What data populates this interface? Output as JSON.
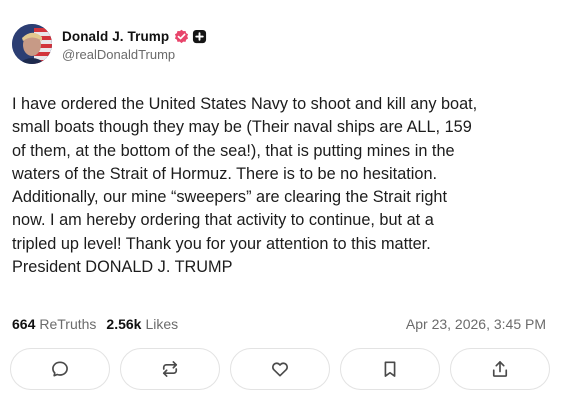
{
  "author": {
    "display_name": "Donald J. Trump",
    "handle": "@realDonaldTrump",
    "verified_color": "#e8456b"
  },
  "post": {
    "text": "I have ordered the United States Navy to shoot and kill any boat,\nsmall boats though they may be (Their naval ships are ALL, 159\nof them, at the bottom of the sea!), that is putting mines in the\nwaters of the Strait of Hormuz. There is to be no hesitation.\nAdditionally, our mine “sweepers” are clearing the Strait right\nnow. I am hereby ordering that activity to continue, but at a\ntripled up level! Thank you for your attention to this matter.\nPresident DONALD J. TRUMP",
    "retruths_count": "664",
    "retruths_label": "ReTruths",
    "likes_count": "2.56k",
    "likes_label": "Likes",
    "timestamp": "Apr 23, 2026, 3:45 PM"
  },
  "actions": [
    {
      "icon": "reply-icon"
    },
    {
      "icon": "retruth-icon"
    },
    {
      "icon": "heart-icon"
    },
    {
      "icon": "bookmark-icon"
    },
    {
      "icon": "share-icon"
    }
  ]
}
